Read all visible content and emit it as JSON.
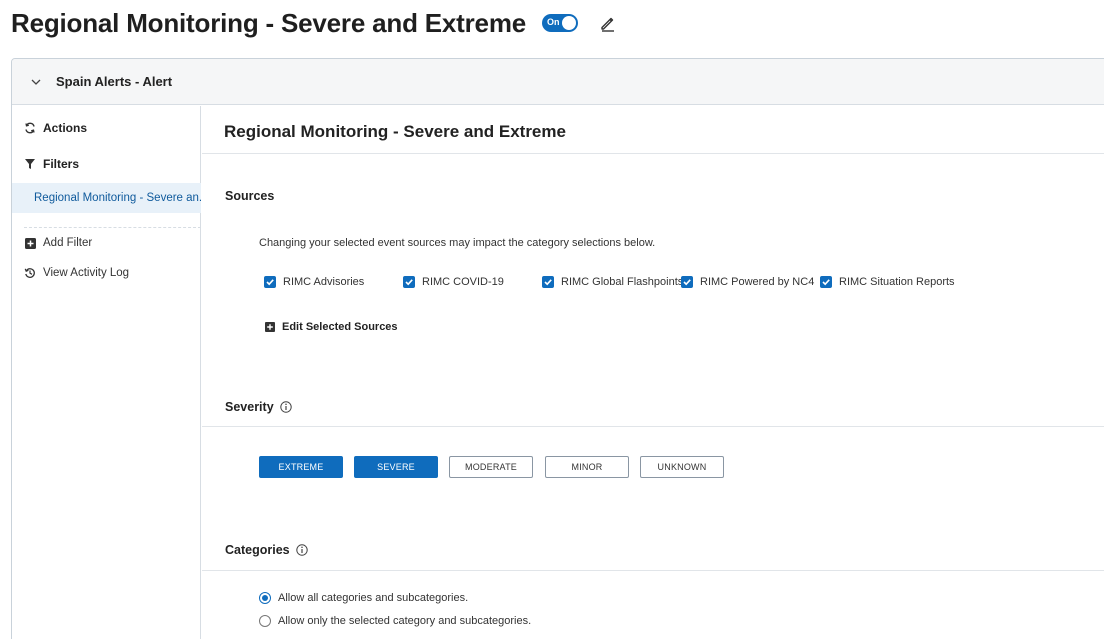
{
  "page": {
    "title": "Regional Monitoring - Severe and Extreme",
    "toggle_label": "On"
  },
  "panel": {
    "title": "Spain Alerts - Alert"
  },
  "sidebar": {
    "actions": "Actions",
    "filters": "Filters",
    "active_filter": "Regional Monitoring - Severe an...",
    "add_filter": "Add Filter",
    "view_activity_log": "View Activity Log"
  },
  "main": {
    "title": "Regional Monitoring - Severe and Extreme"
  },
  "sources": {
    "heading": "Sources",
    "hint": "Changing your selected event sources may impact the category selections below.",
    "items": [
      {
        "label": "RIMC Advisories",
        "checked": true
      },
      {
        "label": "RIMC COVID-19",
        "checked": true
      },
      {
        "label": "RIMC Global Flashpoints",
        "checked": true
      },
      {
        "label": "RIMC Powered by NC4",
        "checked": true
      },
      {
        "label": "RIMC Situation Reports",
        "checked": true
      }
    ],
    "edit_label": "Edit Selected Sources"
  },
  "severity": {
    "heading": "Severity",
    "levels": [
      {
        "label": "EXTREME",
        "selected": true
      },
      {
        "label": "SEVERE",
        "selected": true
      },
      {
        "label": "MODERATE",
        "selected": false
      },
      {
        "label": "MINOR",
        "selected": false
      },
      {
        "label": "UNKNOWN",
        "selected": false
      }
    ]
  },
  "categories": {
    "heading": "Categories",
    "options": [
      {
        "label": "Allow all categories and subcategories.",
        "selected": true
      },
      {
        "label": "Allow only the selected category and subcategories.",
        "selected": false
      }
    ]
  },
  "colors": {
    "accent": "#0f6cbd",
    "active_bg": "#e8f1f9"
  }
}
